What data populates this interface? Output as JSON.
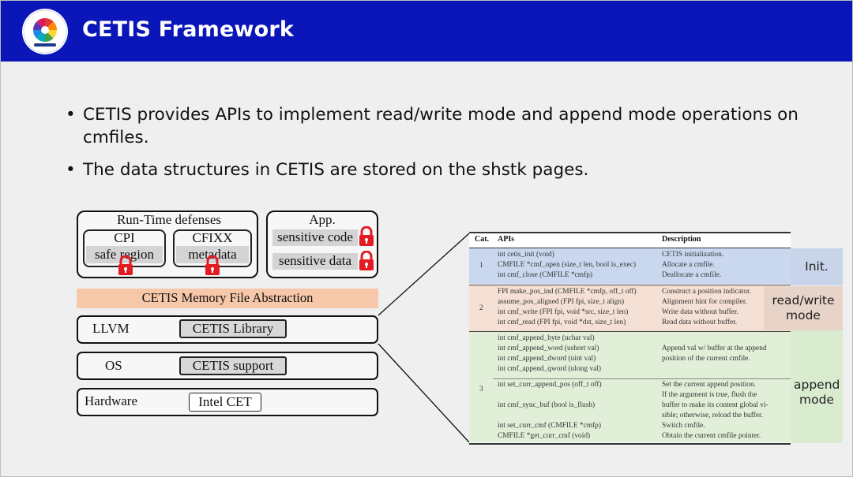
{
  "header": {
    "title": "CETIS Framework",
    "logo_icon": "infosec-logo-icon"
  },
  "bullets": [
    "CETIS provides APIs to implement read/write mode and append mode operations on cmfiles.",
    "The data structures in CETIS are stored on the shstk pages."
  ],
  "diagram": {
    "runtime_title": "Run-Time defenses",
    "cpi": {
      "name": "CPI",
      "sub": "safe region"
    },
    "cfixx": {
      "name": "CFIXX",
      "sub": "metadata"
    },
    "app": {
      "title": "App.",
      "code": "sensitive code",
      "data": "sensitive data"
    },
    "mfa": "CETIS Memory File Abstraction",
    "llvm": {
      "label": "LLVM",
      "component": "CETIS Library"
    },
    "os": {
      "label": "OS",
      "component": "CETIS support"
    },
    "hardware": {
      "label": "Hardware",
      "component": "Intel CET"
    }
  },
  "table": {
    "headers": {
      "cat": "Cat.",
      "apis": "APIs",
      "desc": "Description"
    },
    "groups": [
      {
        "cat": "1",
        "tag": "Init.",
        "color": "#c9d7ee",
        "tag_color": "#c7d3ea",
        "apis": [
          "int cetis_init (void)",
          "CMFILE *cmf_open (size_t len, bool is_exec)",
          "int cmf_close (CMFILE *cmfp)"
        ],
        "descs": [
          "CETIS initialization.",
          "Allocate a cmfile.",
          "Deallocate a cmfile."
        ]
      },
      {
        "cat": "2",
        "tag": "read/write mode",
        "color": "#f3dfd3",
        "tag_color": "#e7d2c7",
        "apis": [
          "FPI make_pos_ind (CMFILE *cmfp, off_t off)",
          "assume_pos_aligned (FPI fpi, size_t align)",
          "int cmf_write (FPI fpi, void *src, size_t len)",
          "int cmf_read (FPI fpi, void *dst, size_t len)"
        ],
        "descs": [
          "Construct a position indicator.",
          "Alignment hint for compiler.",
          "Write data without buffer.",
          "Read data without buffer."
        ]
      },
      {
        "cat": "3",
        "tag": "append mode",
        "color": "#e0efd8",
        "tag_color": "#d9ecd0",
        "apis": [
          "int cmf_append_byte (uchar val)",
          "int cmf_append_word (ushort val)",
          "int cmf_append_dword (uint val)",
          "int cmf_append_qword (ulong val)",
          "int set_curr_append_pos (off_t off)",
          "int cmf_sync_buf (bool is_flush)",
          "int set_curr_cmf (CMFILE *cmfp)",
          "CMFILE *get_curr_cmf (void)"
        ],
        "descs": [
          "Append val w/ buffer at the append",
          "position of the current cmfile.",
          "Set the current append position.",
          "If the argument is true, flush the",
          "buffer to make its content global vi-",
          "sible; otherwise, reload the buffer.",
          "Switch cmfile.",
          "Obtain the current cmfile pointer."
        ]
      }
    ]
  }
}
